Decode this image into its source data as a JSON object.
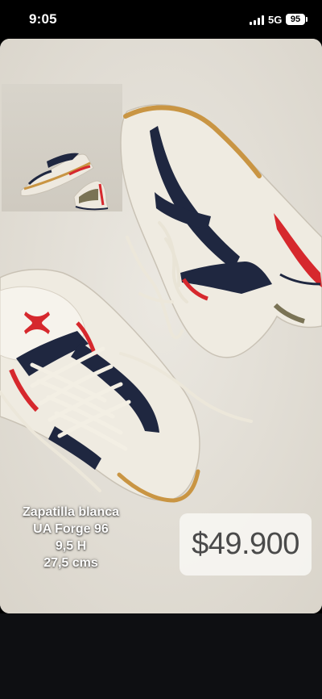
{
  "status_bar": {
    "time": "9:05",
    "network": "5G",
    "battery": "95"
  },
  "story": {
    "caption_lines": [
      "Zapatilla blanca",
      "UA Forge 96",
      "9,5 H",
      "27,5 cms"
    ],
    "price": "$49.900",
    "icons": {
      "main_image": "sneakers-photo-icon",
      "inset_image": "sneakers-thumbnail-icon"
    }
  },
  "colors": {
    "background": "#000000",
    "photo_background": "#e5e1d8",
    "shoe_white": "#efebe1",
    "shoe_navy": "#1f2740",
    "shoe_red": "#d6282d",
    "sole_gum": "#c99543",
    "price_text": "#4a4a4a"
  }
}
